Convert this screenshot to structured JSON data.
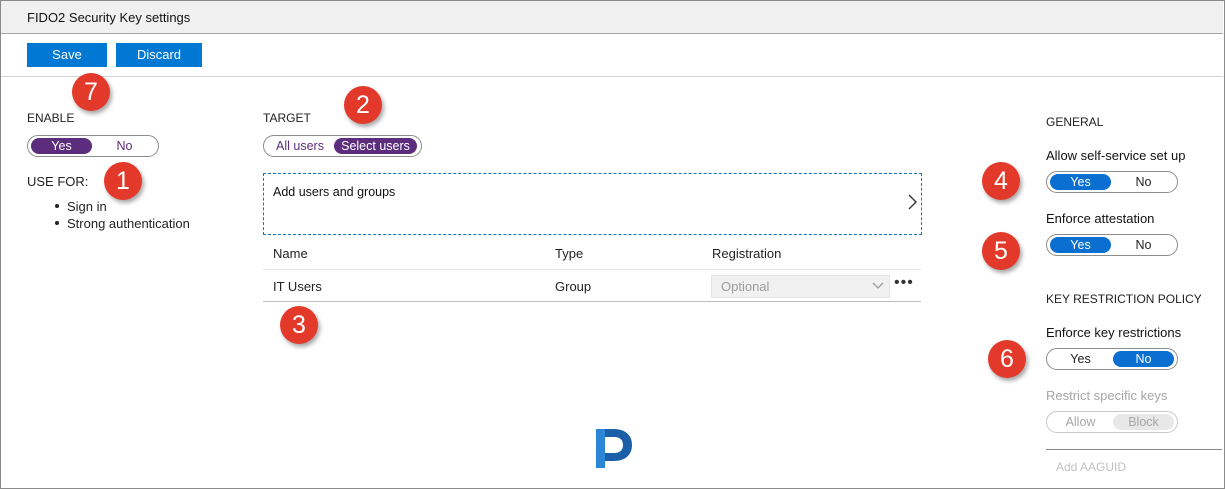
{
  "window": {
    "title": "FIDO2 Security Key settings"
  },
  "toolbar": {
    "save_label": "Save",
    "discard_label": "Discard"
  },
  "enable": {
    "heading": "ENABLE",
    "yes": "Yes",
    "no": "No",
    "selected": "Yes"
  },
  "use_for": {
    "heading": "USE FOR:",
    "items": [
      "Sign in",
      "Strong authentication"
    ]
  },
  "target": {
    "heading": "TARGET",
    "all_users": "All users",
    "select_users": "Select users",
    "selected": "Select users"
  },
  "add_users": {
    "label": "Add users and groups"
  },
  "table": {
    "columns": [
      "Name",
      "Type",
      "Registration"
    ],
    "rows": [
      {
        "name": "IT Users",
        "type": "Group",
        "registration": "Optional"
      }
    ]
  },
  "general": {
    "heading": "GENERAL",
    "self_service": {
      "label": "Allow self-service set up",
      "yes": "Yes",
      "no": "No",
      "selected": "Yes"
    },
    "attestation": {
      "label": "Enforce attestation",
      "yes": "Yes",
      "no": "No",
      "selected": "Yes"
    }
  },
  "key_restriction": {
    "heading": "KEY RESTRICTION POLICY",
    "enforce": {
      "label": "Enforce key restrictions",
      "yes": "Yes",
      "no": "No",
      "selected": "No"
    },
    "restrict": {
      "label": "Restrict specific keys",
      "allow": "Allow",
      "block": "Block",
      "selected": "Block"
    },
    "add_aaguid": "Add AAGUID"
  },
  "annotations": [
    "1",
    "2",
    "3",
    "4",
    "5",
    "6",
    "7"
  ],
  "colors": {
    "accent_blue": "#0078d4",
    "toggle_purple": "#5c2d7d",
    "badge_red": "#e3392a"
  },
  "logo": {
    "letter": "P"
  }
}
